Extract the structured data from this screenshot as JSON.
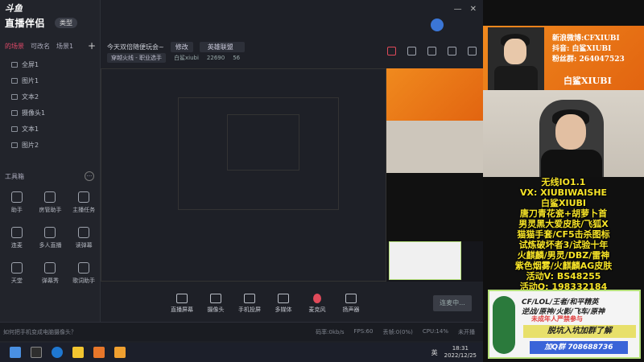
{
  "app": {
    "logo_top": "斗鱼",
    "logo": "直播伴侣",
    "type_button": "类型",
    "scene_tabs": [
      "的场景",
      "可改名",
      "场景1"
    ],
    "sources": [
      {
        "label": "全屏1"
      },
      {
        "label": "图片1"
      },
      {
        "label": "文本2"
      },
      {
        "label": "摄像头1"
      },
      {
        "label": "文本1"
      },
      {
        "label": "图片2"
      }
    ],
    "tools_title": "工具箱",
    "tools": [
      "助手",
      "房管助手",
      "主播任务",
      "连麦",
      "多人直播",
      "读弹幕",
      "天堂",
      "弹幕秀",
      "歌词助手"
    ],
    "title_text": "今天双倍随便玩会~",
    "edit_button": "修改",
    "category": "英雄联盟",
    "sub_chip": "穿越火线 - 职业选手",
    "room_label": "白鲨xiubi",
    "room_id": "22690",
    "fans": "56"
  },
  "bottom_toolbar": {
    "items": [
      "直播屏幕",
      "摄像头",
      "手机投屏",
      "多媒体",
      "麦克风",
      "扬声器"
    ],
    "start_button": "连麦中..."
  },
  "status": {
    "question": "如何把手机变成电脑摄像头？",
    "stats": [
      "码率:0kb/s",
      "FPS:60",
      "丢帧:0(0%)",
      "CPU:14%",
      "未开播"
    ]
  },
  "taskbar": {
    "time": "18:31",
    "date": "2022/12/25",
    "lang": "英"
  },
  "overlay": {
    "weibo": "新浪微博:CFXIUBI",
    "douyin": "抖音: 白鲨XIUBI",
    "fans": "粉丝群: 264047523",
    "name": "白鲨XIUBI",
    "promo_lines": [
      "无线IO1.1",
      "VX: XIUBIWAISHE",
      "白鲨XIUBI",
      "唐刀青花瓷+胡萝卜首",
      "男灵黑大爱皮肤/飞狐X",
      "猫猫手套/CF5击杀图标",
      "试炼破坏者3/试验十年",
      "火麒麟/男灵/DBZ/雷神",
      "紫色烟雾/火麒麟AG皮肤",
      "活动V: BS48255",
      "活动Q: 198332184"
    ],
    "card": {
      "line1": "CF/LOL/王者/和平精英",
      "line2": "逆战/原神/火影/飞车/原神",
      "line3": "未成年人严禁参与",
      "line4": "脱坑入坑加群了解",
      "line5": "加Q群 708688736"
    }
  },
  "colors": {
    "accent": "#e24a6a",
    "orange": "#f08a1e",
    "yellow": "#f7e428"
  }
}
